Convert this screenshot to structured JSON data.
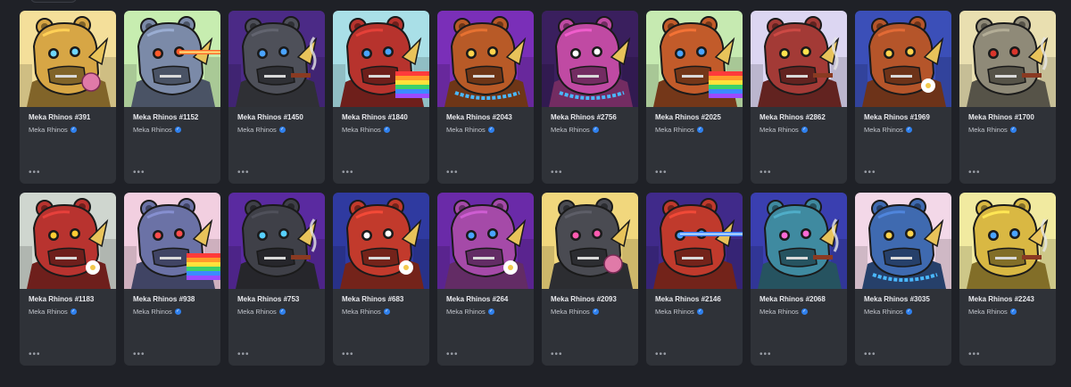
{
  "collection_name": "Meka Rhinos",
  "more_label": "•••",
  "verified_glyph": "✓",
  "cards": [
    {
      "title": "Meka Rhinos #391",
      "bg": "#f4df9a",
      "body": "#d7a645",
      "eye": "#6fd6ff",
      "acc": "gum"
    },
    {
      "title": "Meka Rhinos #1152",
      "bg": "#c7edb0",
      "body": "#7b8aa8",
      "eye": "#ff5a2a",
      "acc": "laser-red"
    },
    {
      "title": "Meka Rhinos #1450",
      "bg": "#4b2a86",
      "body": "#4e5059",
      "eye": "#4aa3ff",
      "acc": "cigar"
    },
    {
      "title": "Meka Rhinos #1840",
      "bg": "#a9dfe7",
      "body": "#b7332d",
      "eye": "#4aa3ff",
      "acc": "rainbow"
    },
    {
      "title": "Meka Rhinos #2043",
      "bg": "#7a2fb8",
      "body": "#b85a27",
      "eye": "#ffd34d",
      "acc": "chain-blue"
    },
    {
      "title": "Meka Rhinos #2756",
      "bg": "#3a1f5e",
      "body": "#c04aa3",
      "eye": "#ffffff",
      "acc": "chain-blue"
    },
    {
      "title": "Meka Rhinos #2025",
      "bg": "#c6eab1",
      "body": "#c25b2a",
      "eye": "#4aa3ff",
      "acc": "rainbow"
    },
    {
      "title": "Meka Rhinos #2862",
      "bg": "#dcd6f2",
      "body": "#a33a36",
      "eye": "#ffe24d",
      "acc": "cigar"
    },
    {
      "title": "Meka Rhinos #1969",
      "bg": "#3b4fb8",
      "body": "#b5552a",
      "eye": "#ffd34d",
      "acc": "flower"
    },
    {
      "title": "Meka Rhinos #1700",
      "bg": "#e9dfb0",
      "body": "#8f8a78",
      "eye": "#d9352b",
      "acc": "cigar"
    },
    {
      "title": "Meka Rhinos #1183",
      "bg": "#cfd6cf",
      "body": "#b8332f",
      "eye": "#ffcc33",
      "acc": "flower"
    },
    {
      "title": "Meka Rhinos #938",
      "bg": "#f2cfe0",
      "body": "#6b72a6",
      "eye": "#ff4d4d",
      "acc": "rainbow"
    },
    {
      "title": "Meka Rhinos #753",
      "bg": "#5a2aa0",
      "body": "#3f4048",
      "eye": "#57d0ff",
      "acc": "cigar"
    },
    {
      "title": "Meka Rhinos #683",
      "bg": "#2f3aa0",
      "body": "#c23a2c",
      "eye": "#ffffff",
      "acc": "flower"
    },
    {
      "title": "Meka Rhinos #264",
      "bg": "#6a2aa8",
      "body": "#a54aa8",
      "eye": "#4aa3ff",
      "acc": "flower"
    },
    {
      "title": "Meka Rhinos #2093",
      "bg": "#f1d77d",
      "body": "#4a4b52",
      "eye": "#ff5ab0",
      "acc": "gum"
    },
    {
      "title": "Meka Rhinos #2146",
      "bg": "#402a8a",
      "body": "#c03a2c",
      "eye": "#4aa3ff",
      "acc": "laser-blue"
    },
    {
      "title": "Meka Rhinos #2068",
      "bg": "#3a3fb0",
      "body": "#3f8aa0",
      "eye": "#ff6ad5",
      "acc": "cigar"
    },
    {
      "title": "Meka Rhinos #3035",
      "bg": "#f3d8e8",
      "body": "#3f6ab0",
      "eye": "#ffd34d",
      "acc": "chain-blue"
    },
    {
      "title": "Meka Rhinos #2243",
      "bg": "#f1eaa0",
      "body": "#d9b843",
      "eye": "#4aa3ff",
      "acc": "cigar"
    }
  ]
}
